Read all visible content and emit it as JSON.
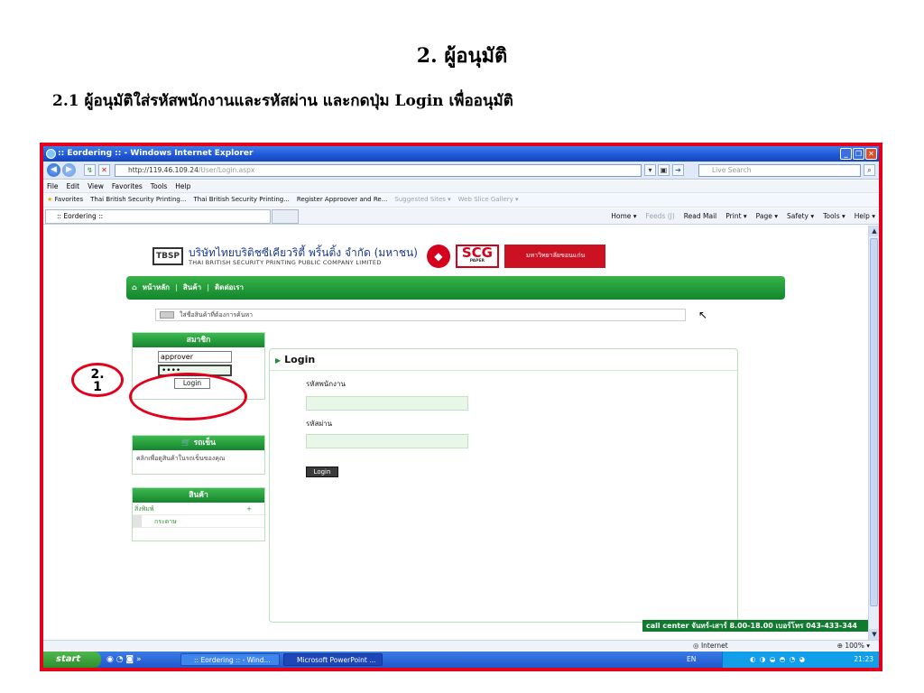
{
  "slide": {
    "heading": "2.  ผู้อนุมัติ",
    "subheading": "2.1  ผู้อนุมัติใส่รหัสพนักงานและรหัสผ่าน และกดปุ่ม Login เพื่ออนุมัติ",
    "step_label": "2.\n1"
  },
  "browser": {
    "title": ":: Eordering :: - Windows Internet Explorer",
    "url_prefix": "http://119.46.109.24",
    "url_path": "/User/Login.aspx",
    "search_placeholder": "Live Search",
    "menu": [
      "File",
      "Edit",
      "View",
      "Favorites",
      "Tools",
      "Help"
    ],
    "favorites_label": "Favorites",
    "favorites": [
      "Thai British Security Printing...",
      "Thai British Security Printing...",
      "Register Approover and Re..."
    ],
    "favorites_dim": [
      "Suggested Sites ▾",
      "Web Slice Gallery ▾"
    ],
    "tab_title": ":: Eordering ::",
    "commands": [
      "Home ▾",
      "Read Mail",
      "Print ▾",
      "Page ▾",
      "Safety ▾",
      "Tools ▾",
      "Help ▾"
    ],
    "feeds": "Feeds (J)",
    "status_zone": "Internet",
    "zoom": "100%"
  },
  "site": {
    "logo_abbr": "TBSP",
    "company_th": "บริษัทไทยบริติชซีเคียวริตี้ พริ้นติ้ง จำกัด (มหาชน)",
    "company_en": "THAI BRITISH SECURITY PRINTING PUBLIC COMPANY LIMITED",
    "scg": "SCG",
    "scg_sub": "PAPER",
    "uni": "มหาวิทยาลัยขอนแก่น",
    "nav": [
      "หน้าหลัก",
      "สินค้า",
      "ติดต่อเรา"
    ],
    "search_placeholder": "ใส่ชื่อสินค้าที่ต้องการค้นหา",
    "member_title": "สมาชิก",
    "member_username": "approver",
    "member_password": "••••",
    "member_login": "Login",
    "cart_title": "รถเข็น",
    "cart_link": "คลิกเพื่อดูสินค้าในรถเข็นของคุณ",
    "products_title": "สินค้า",
    "products": [
      "สิ่งพิมพ์",
      "กระดาษ"
    ],
    "login_title": "Login",
    "label_employee": "รหัสพนักงาน",
    "label_password": "รหัสผ่าน",
    "login_button": "Login",
    "call_center": "call center จันทร์-เสาร์ 8.00-18.00 เบอร์โทร 043-433-344"
  },
  "taskbar": {
    "start": "start",
    "tasks": [
      ":: Eordering :: - Wind...",
      "Microsoft PowerPoint ..."
    ],
    "lang": "EN",
    "clock": "21:23"
  }
}
